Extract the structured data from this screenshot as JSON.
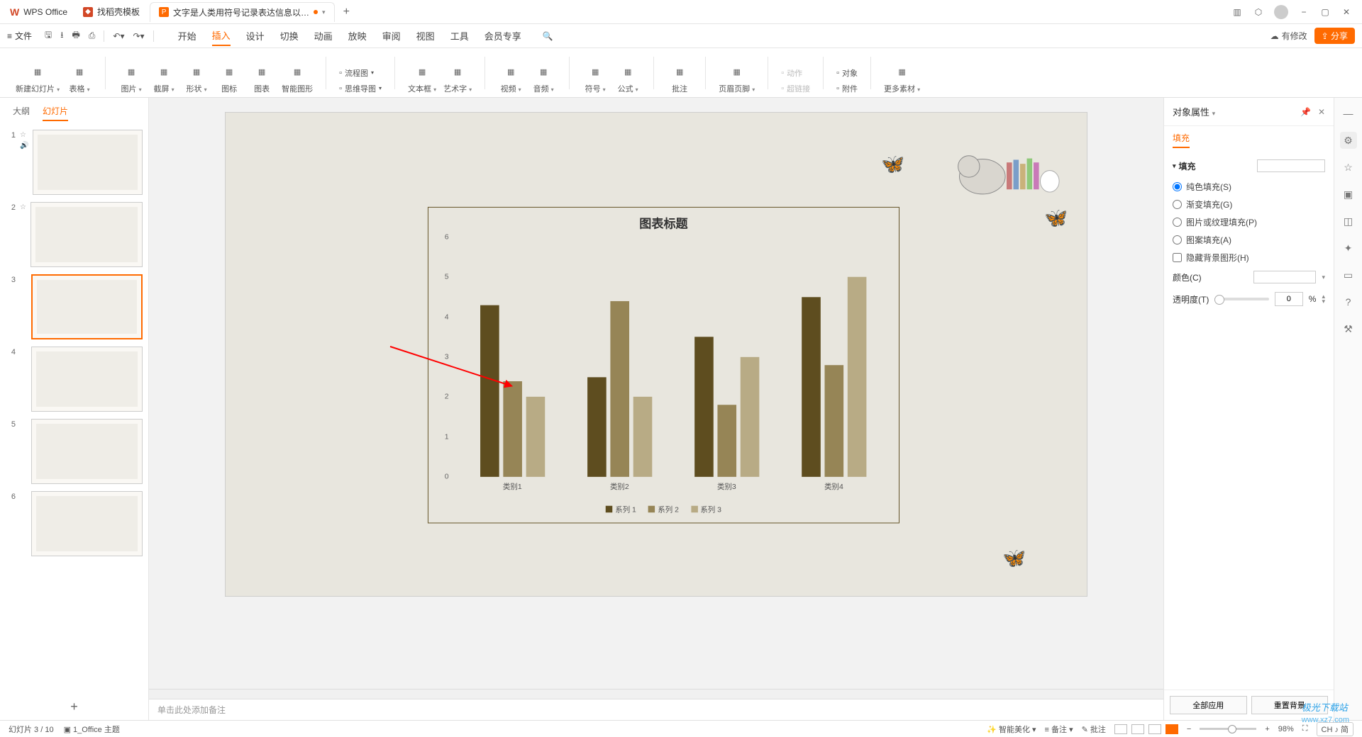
{
  "titlebar": {
    "app": "WPS Office",
    "tabs": [
      {
        "icon": "red",
        "label": "找稻壳模板"
      },
      {
        "icon": "orange",
        "label": "文字是人类用符号记录表达信息以…",
        "dirty": true,
        "active": true
      }
    ]
  },
  "window_controls": {
    "minimize": "−",
    "restore": "▢",
    "close": "✕"
  },
  "menubar": {
    "file": "文件",
    "menus": [
      "开始",
      "插入",
      "设计",
      "切换",
      "动画",
      "放映",
      "审阅",
      "视图",
      "工具",
      "会员专享"
    ],
    "active": "插入",
    "modify": "有修改",
    "share": "分享"
  },
  "ribbon": {
    "groups": [
      [
        {
          "label": "新建幻灯片",
          "dd": true
        },
        {
          "label": "表格",
          "dd": true
        }
      ],
      [
        {
          "label": "图片",
          "dd": true
        },
        {
          "label": "截屏",
          "dd": true
        },
        {
          "label": "形状",
          "dd": true
        },
        {
          "label": "图标"
        },
        {
          "label": "图表"
        },
        {
          "label": "智能图形"
        }
      ],
      [
        {
          "label": "流程图",
          "dd": true,
          "row": true
        },
        {
          "label": "思维导图",
          "dd": true,
          "row": true
        }
      ],
      [
        {
          "label": "文本框",
          "dd": true
        },
        {
          "label": "艺术字",
          "dd": true
        }
      ],
      [
        {
          "label": "视频",
          "dd": true
        },
        {
          "label": "音频",
          "dd": true
        }
      ],
      [
        {
          "label": "符号",
          "dd": true
        },
        {
          "label": "公式",
          "dd": true
        }
      ],
      [
        {
          "label": "批注"
        }
      ],
      [
        {
          "label": "页眉页脚",
          "dd": true
        }
      ],
      [
        {
          "label": "动作",
          "row": true,
          "disabled": true
        },
        {
          "label": "超链接",
          "row": true,
          "disabled": true
        }
      ],
      [
        {
          "label": "对象",
          "row": true
        },
        {
          "label": "附件",
          "row": true
        }
      ],
      [
        {
          "label": "更多素材",
          "dd": true
        }
      ]
    ]
  },
  "slidepanel": {
    "tabs": [
      "大纲",
      "幻灯片"
    ],
    "active": "幻灯片",
    "slides": [
      1,
      2,
      3,
      4,
      5,
      6
    ],
    "active_slide": 3
  },
  "chart_data": {
    "type": "bar",
    "title": "图表标题",
    "categories": [
      "类别1",
      "类别2",
      "类别3",
      "类别4"
    ],
    "series": [
      {
        "name": "系列 1",
        "color": "#5e4d1f",
        "values": [
          4.3,
          2.5,
          3.5,
          4.5
        ]
      },
      {
        "name": "系列 2",
        "color": "#968556",
        "values": [
          2.4,
          4.4,
          1.8,
          2.8
        ]
      },
      {
        "name": "系列 3",
        "color": "#b8ab85",
        "values": [
          2.0,
          2.0,
          3.0,
          5.0
        ]
      }
    ],
    "ylim": [
      0,
      6
    ],
    "yticks": [
      0,
      1,
      2,
      3,
      4,
      5,
      6
    ]
  },
  "notes_placeholder": "单击此处添加备注",
  "properties": {
    "title": "对象属性",
    "tab": "填充",
    "section": "填充",
    "options": [
      {
        "label": "纯色填充(S)",
        "type": "radio",
        "checked": true
      },
      {
        "label": "渐变填充(G)",
        "type": "radio",
        "checked": false
      },
      {
        "label": "图片或纹理填充(P)",
        "type": "radio",
        "checked": false
      },
      {
        "label": "图案填充(A)",
        "type": "radio",
        "checked": false
      },
      {
        "label": "隐藏背景图形(H)",
        "type": "checkbox",
        "checked": false
      }
    ],
    "color_label": "颜色(C)",
    "transparency_label": "透明度(T)",
    "transparency_value": "0",
    "transparency_unit": "%",
    "apply_all": "全部应用",
    "reset_bg": "重置背景"
  },
  "status": {
    "page": "幻灯片 3 / 10",
    "theme": "1_Office 主题",
    "beautify": "智能美化",
    "notes": "备注",
    "annotate": "批注",
    "zoom": "98%",
    "expand": "⛶",
    "ime": "CH ♪ 简"
  },
  "watermark": {
    "cn": "极光下载站",
    "url": "www.xz7.com"
  }
}
